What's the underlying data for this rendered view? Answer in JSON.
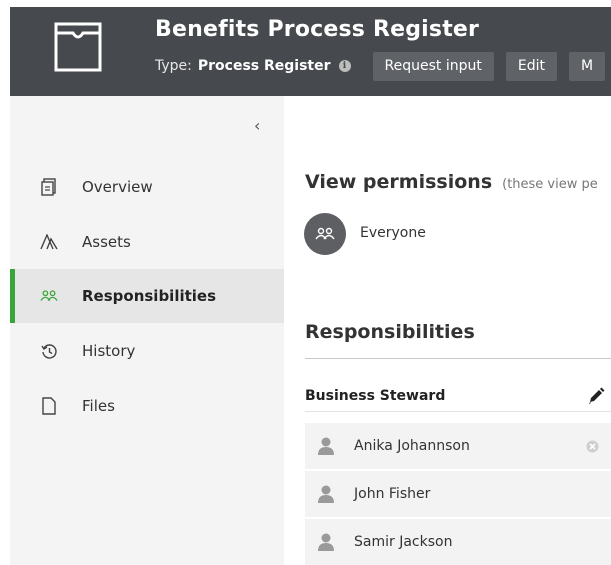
{
  "header": {
    "title": "Benefits Process Register",
    "type_label": "Type:",
    "type_value": "Process Register",
    "buttons": [
      "Request input",
      "Edit",
      "M"
    ]
  },
  "sidebar": {
    "collapse_glyph": "‹",
    "items": [
      {
        "label": "Overview",
        "icon": "document-icon",
        "active": false
      },
      {
        "label": "Assets",
        "icon": "assets-icon",
        "active": false
      },
      {
        "label": "Responsibilities",
        "icon": "people-icon",
        "active": true
      },
      {
        "label": "History",
        "icon": "history-icon",
        "active": false
      },
      {
        "label": "Files",
        "icon": "file-icon",
        "active": false
      }
    ]
  },
  "permissions": {
    "title": "View permissions",
    "subtitle": "(these view pe",
    "entry": "Everyone"
  },
  "responsibilities": {
    "title": "Responsibilities",
    "role": "Business Steward",
    "people": [
      "Anika Johannson",
      "John Fisher",
      "Samir Jackson"
    ]
  },
  "colors": {
    "header_bg": "#46494d",
    "sidebar_bg": "#f4f4f4",
    "active_accent": "#3aa53a"
  }
}
